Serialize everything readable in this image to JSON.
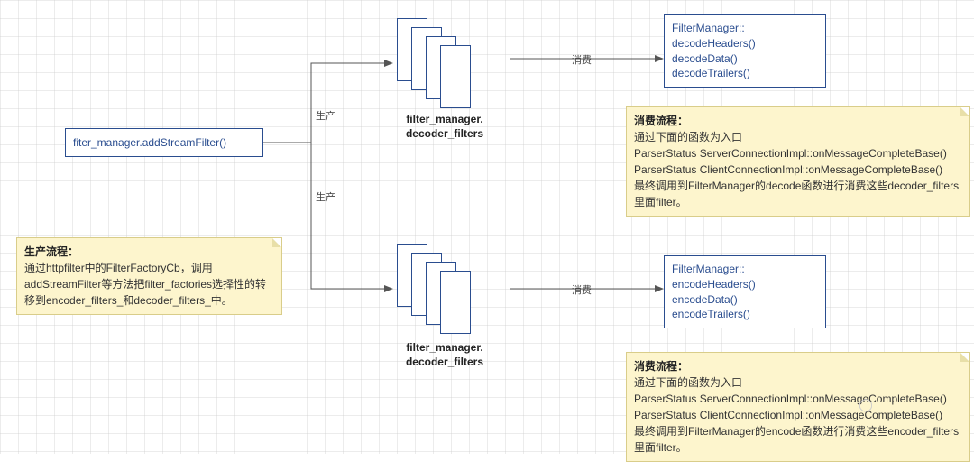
{
  "left_node": {
    "text": "fiter_manager.addStreamFilter()"
  },
  "branch_produce_labels": {
    "top": "生产",
    "bottom": "生产"
  },
  "stacks": {
    "top_label": "filter_manager. decoder_filters",
    "bottom_label": "filter_manager. decoder_filters"
  },
  "consume_labels": {
    "top": "消费",
    "bottom": "消费"
  },
  "decode_box": {
    "line1": "FilterManager::",
    "line2": "decodeHeaders()",
    "line3": "decodeData()",
    "line4": "decodeTrailers()"
  },
  "encode_box": {
    "line1": "FilterManager::",
    "line2": "encodeHeaders()",
    "line3": "encodeData()",
    "line4": "encodeTrailers()"
  },
  "note_left": {
    "title": "生产流程：",
    "body": "通过httpfilter中的FilterFactoryCb，调用addStreamFilter等方法把filter_factories选择性的转移到encoder_filters_和decoder_filters_中。"
  },
  "note_top_right": {
    "title": "消费流程：",
    "l1": "通过下面的函数为入口",
    "l2": "ParserStatus ServerConnectionImpl::onMessageCompleteBase()",
    "l3": "ParserStatus ClientConnectionImpl::onMessageCompleteBase()",
    "l4": "最终调用到FilterManager的decode函数进行消费这些decoder_filters里面filter。"
  },
  "note_bottom_right": {
    "title": "消费流程：",
    "l1": "通过下面的函数为入口",
    "l2": "ParserStatus ServerConnectionImpl::onMessageCompleteBase()",
    "l3": "ParserStatus ClientConnectionImpl::onMessageCompleteBase()",
    "l4": "最终调用到FilterManager的encode函数进行消费这些encoder_filters里面filter。"
  }
}
